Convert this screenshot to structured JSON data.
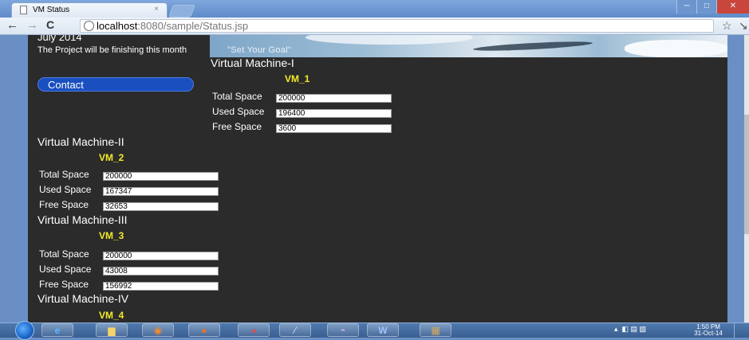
{
  "browser": {
    "tab_title": "VM Status",
    "tab_close": "×",
    "url_host": "localhost",
    "url_path": ":8080/sample/Status.jsp",
    "back_glyph": "←",
    "forward_glyph": "→",
    "reload_glyph": "C",
    "star_glyph": "☆",
    "win_min": "─",
    "win_max": "□",
    "win_close": "✕"
  },
  "sidebar": {
    "date": "July 2014",
    "note": "The Project will be finishing this month",
    "contact_label": "Contact"
  },
  "banner": {
    "slogan": "\"Set Your Goal\""
  },
  "vms": [
    {
      "title": "Virtual Machine-I",
      "code": "VM_1",
      "total_label": "Total Space",
      "total": "200000",
      "used_label": "Used Space",
      "used": "196400",
      "free_label": "Free Space",
      "free": "3600"
    },
    {
      "title": "Virtual Machine-II",
      "code": "VM_2",
      "total_label": "Total Space",
      "total": "200000",
      "used_label": "Used Space",
      "used": "167347",
      "free_label": "Free Space",
      "free": "32653"
    },
    {
      "title": "Virtual Machine-III",
      "code": "VM_3",
      "total_label": "Total Space",
      "total": "200000",
      "used_label": "Used Space",
      "used": "43008",
      "free_label": "Free Space",
      "free": "156992"
    },
    {
      "title": "Virtual Machine-IV",
      "code": "VM_4"
    }
  ],
  "taskbar": {
    "clock_time": "1:50 PM",
    "clock_date": "31-Oct-14"
  },
  "colors": {
    "page_bg": "#2b2b2b",
    "vm_code": "#f2ea2a",
    "contact_button": "#1a4fbf",
    "outer_bg": "#6a8fc4"
  },
  "icons": {
    "taskbar": [
      "ie-icon",
      "explorer-icon",
      "media-player-icon",
      "firefox-icon",
      "chrome-icon",
      "eclipse-icon",
      "app-icon",
      "word-icon",
      "winrar-icon"
    ]
  }
}
